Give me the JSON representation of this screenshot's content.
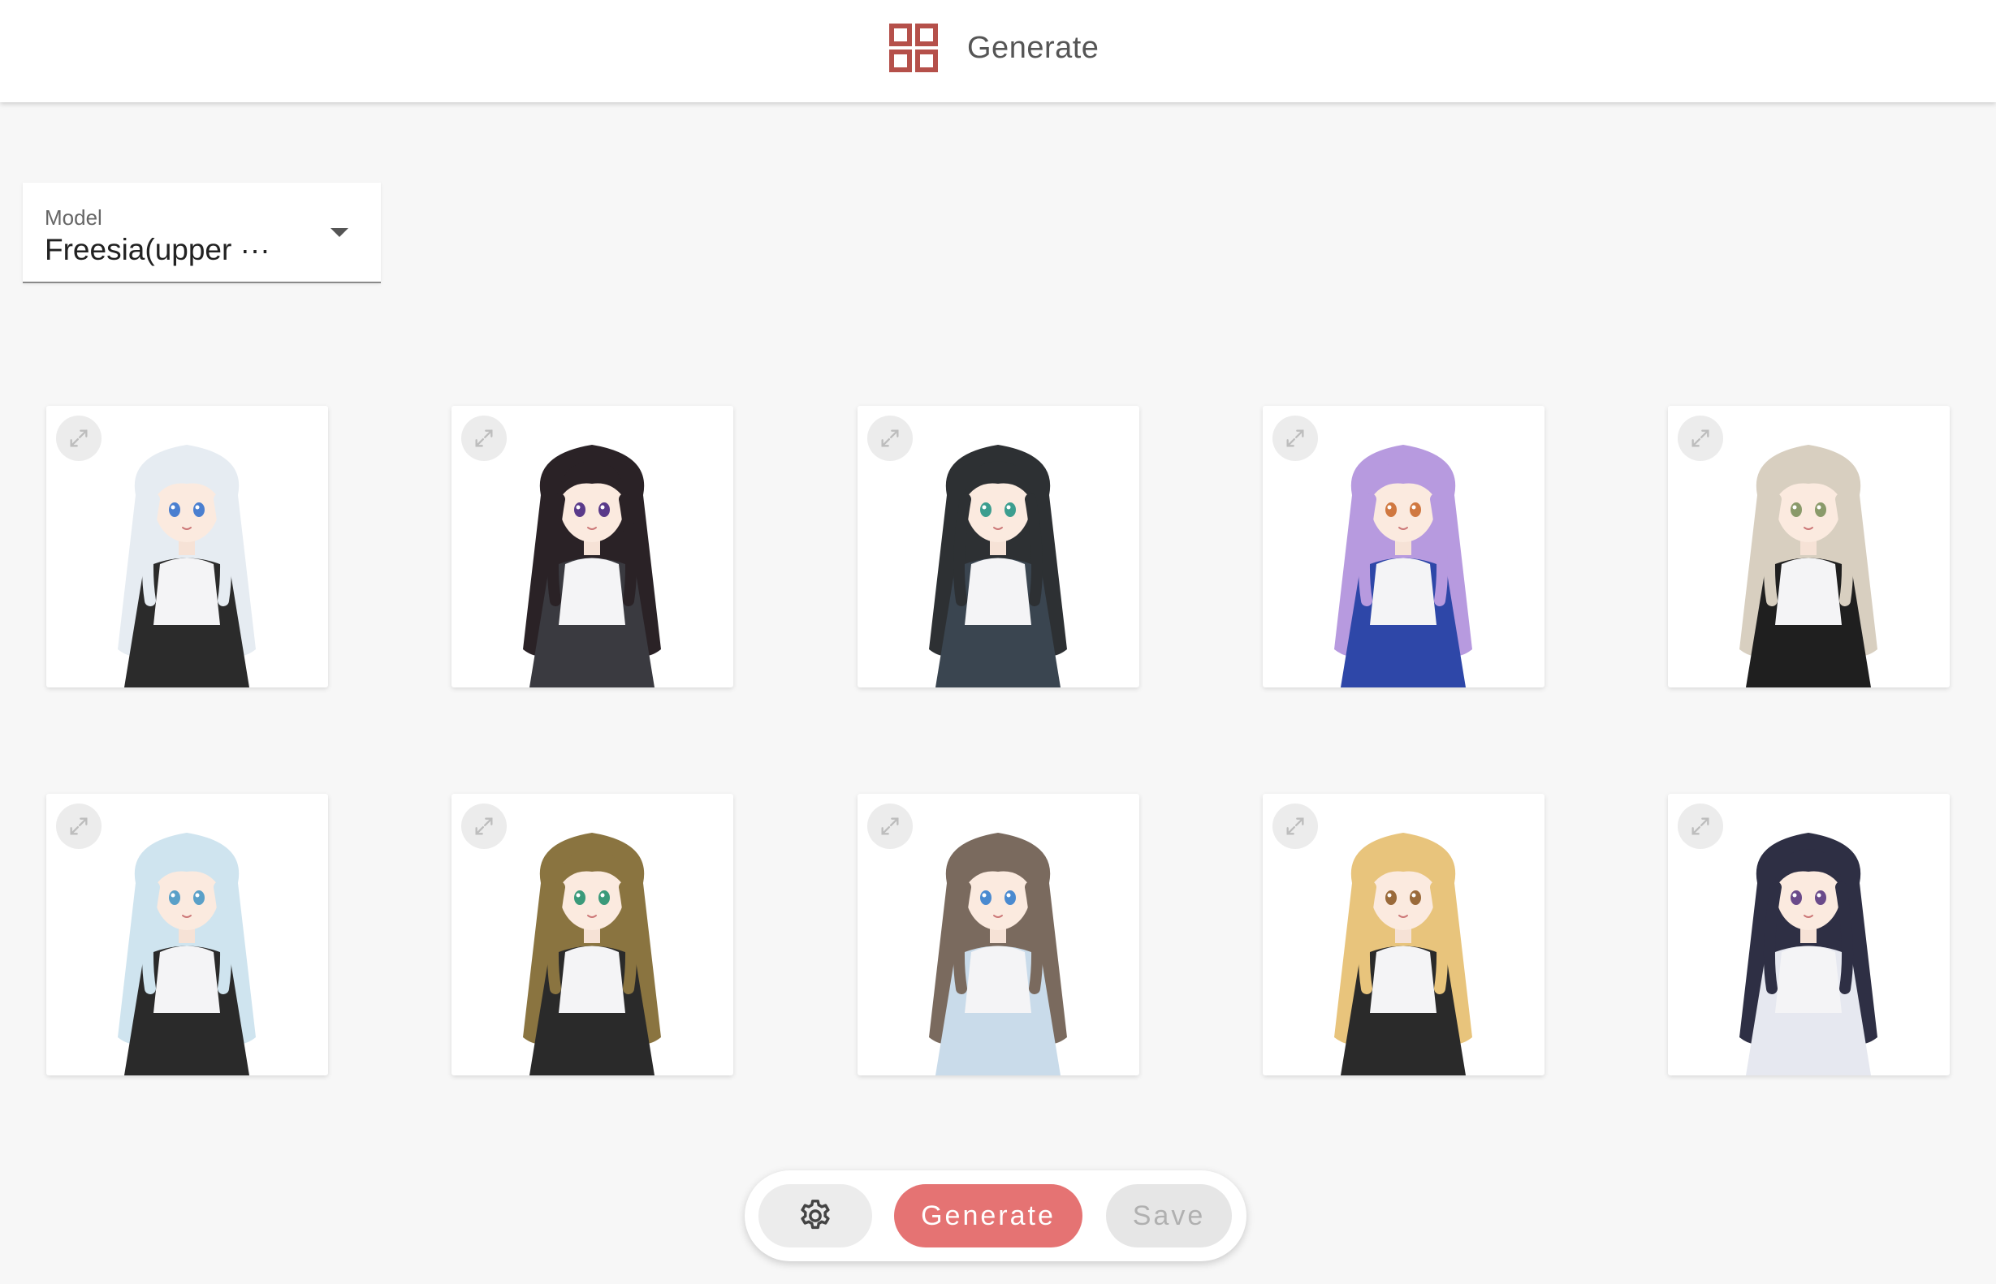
{
  "header": {
    "title": "Generate",
    "icon": "grid-icon",
    "accent_color": "#b5504a"
  },
  "model_select": {
    "label": "Model",
    "value": "Freesia(upper ···"
  },
  "gallery": {
    "cards": [
      {
        "hair": "#e6ecf2",
        "eyes": "#4a7fd0",
        "outfit": "#2b2b2b"
      },
      {
        "hair": "#2a2226",
        "eyes": "#5a3a8a",
        "outfit": "#3a3a40"
      },
      {
        "hair": "#2d3033",
        "eyes": "#3c9e8f",
        "outfit": "#3a4550"
      },
      {
        "hair": "#b79adf",
        "eyes": "#d07840",
        "outfit": "#2e47a8"
      },
      {
        "hair": "#d8cfc0",
        "eyes": "#8a9a6a",
        "outfit": "#1f1f1f"
      },
      {
        "hair": "#cfe4ef",
        "eyes": "#5aa0c8",
        "outfit": "#2a2a2a"
      },
      {
        "hair": "#8a7440",
        "eyes": "#3a9a7a",
        "outfit": "#2a2a2a"
      },
      {
        "hair": "#7a6a5e",
        "eyes": "#4a8ad0",
        "outfit": "#c9dbea"
      },
      {
        "hair": "#e8c47c",
        "eyes": "#9a6a3a",
        "outfit": "#2a2a2a"
      },
      {
        "hair": "#2e2f44",
        "eyes": "#6a4a8a",
        "outfit": "#e6e8f0"
      }
    ]
  },
  "actions": {
    "settings_icon": "gear-icon",
    "generate_label": "Generate",
    "save_label": "Save",
    "generate_color": "#e57373"
  }
}
